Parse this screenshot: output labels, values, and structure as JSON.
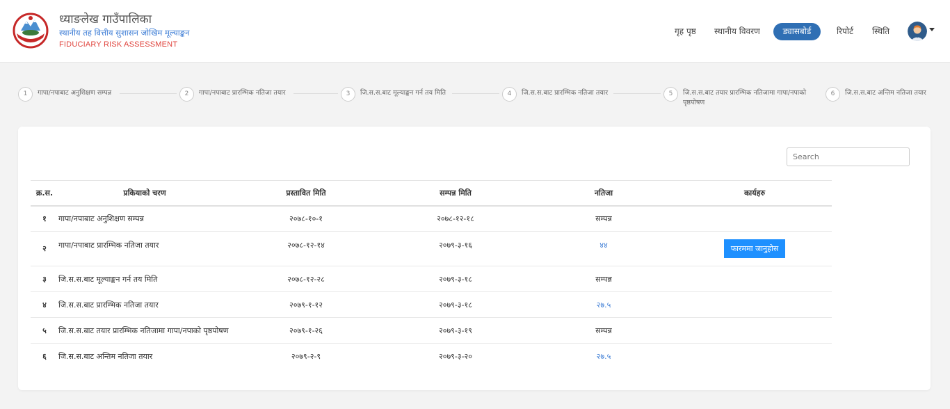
{
  "header": {
    "title": "ध्याङलेख गाउँपालिका",
    "subtitle": "स्थानीय तह वित्तीय सुशासन जोखिम मूल्याङ्कन",
    "subtitle_en": "FIDUCIARY RISK ASSESSMENT",
    "nav": {
      "home": "गृह पृष्ठ",
      "local_details": "स्थानीय विवरण",
      "dashboard": "ड्यासबोर्ड",
      "report": "रिपोर्ट",
      "status": "स्थिति"
    },
    "active_color": "#2f6fb4"
  },
  "steps": [
    {
      "num": "1",
      "label": "गापा/नपाबाट अनुशिक्षण सम्पन्न"
    },
    {
      "num": "2",
      "label": "गापा/नपाबाट प्रारम्भिक नतिजा तयार"
    },
    {
      "num": "3",
      "label": "जि.स.स.बाट मूल्याङ्कन गर्न तय मिति"
    },
    {
      "num": "4",
      "label": "जि.स.स.बाट प्रारम्भिक नतिजा तयार"
    },
    {
      "num": "5",
      "label": "जि.स.स.बाट तयार प्रारम्भिक नतिजामा गापा/नपाको पृष्ठपोषण"
    },
    {
      "num": "6",
      "label": "जि.स.स.बाट अन्तिम नतिजा तयार"
    }
  ],
  "search": {
    "placeholder": "Search"
  },
  "table": {
    "headers": [
      "क्र.स.",
      "प्रकियाको चरण",
      "प्रस्तावित मिति",
      "सम्पन्न मिति",
      "नतिजा",
      "कार्यहरु"
    ],
    "rows": [
      {
        "sn": "१",
        "process": "गापा/नपाबाट अनुशिक्षण सम्पन्न",
        "proposed": "२०७८-१०-१",
        "completed": "२०७८-१२-१८",
        "result": "सम्पन्न",
        "action": ""
      },
      {
        "sn": "२",
        "process": "गापा/नपाबाट प्रारम्भिक नतिजा तयार",
        "proposed": "२०७८-१२-१४",
        "completed": "२०७९-३-१६",
        "result": "४४",
        "action": "फारममा जानुहोस"
      },
      {
        "sn": "३",
        "process": "जि.स.स.बाट मूल्याङ्कन गर्न तय मिति",
        "proposed": "२०७८-१२-२८",
        "completed": "२०७९-३-१८",
        "result": "सम्पन्न",
        "action": ""
      },
      {
        "sn": "४",
        "process": "जि.स.स.बाट प्रारम्भिक नतिजा तयार",
        "proposed": "२०७९-१-१२",
        "completed": "२०७९-३-१८",
        "result": "२७.५",
        "action": ""
      },
      {
        "sn": "५",
        "process": "जि.स.स.बाट तयार प्रारम्भिक नतिजामा गापा/नपाको पृष्ठपोषण",
        "proposed": "२०७९-१-२६",
        "completed": "२०७९-३-१९",
        "result": "सम्पन्न",
        "action": ""
      },
      {
        "sn": "६",
        "process": "जि.स.स.बाट अन्तिम नतिजा तयार",
        "proposed": "२०७९-२-९",
        "completed": "२०७९-३-२०",
        "result": "२७.५",
        "action": ""
      }
    ]
  }
}
